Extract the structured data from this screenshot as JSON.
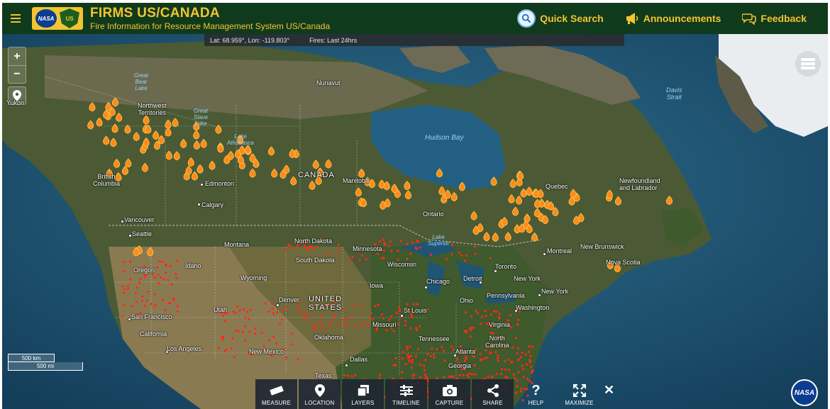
{
  "header": {
    "title": "FIRMS US/CANADA",
    "subtitle": "Fire Information for Resource Management System US/Canada",
    "logo_left": "NASA",
    "logo_right": "US",
    "actions": {
      "quick_search": "Quick Search",
      "announcements": "Announcements",
      "feedback": "Feedback"
    },
    "colors": {
      "bar": "#103a1c",
      "accent": "#f4c430"
    }
  },
  "coord_bar": {
    "latlon": "Lat: 68.959°, Lon: -119.803°",
    "fires": "Fires: Last 24hrs"
  },
  "map_controls": {
    "zoom_in": "+",
    "zoom_out": "−"
  },
  "labels": {
    "yukon": "Yukon",
    "great_bear_lake": "Great\nBear\nLake",
    "nunavut": "Nunavut",
    "northwest_territories": "Northwest\nTerritories",
    "great_slave_lake": "Great\nSlave\nLake",
    "lake_athabasca": "Lake\nAthabasca",
    "hudson_bay": "Hudson Bay",
    "davis_strait": "Davis\nStrait",
    "british_columbia": "British\nColumbia",
    "canada": "CANADA",
    "edmonton": "Edmonton",
    "manitoba": "Manitoba",
    "quebec": "Quebec",
    "newfoundland": "Newfoundland\nand Labrador",
    "calgary": "Calgary",
    "ontario": "Ontario",
    "vancouver": "Vancouver",
    "seattle": "Seattle",
    "north_dakota": "North Dakota",
    "lake_superior": "Lake\nSuperior",
    "montreal": "Montreal",
    "new_brunswick": "New Brunswick",
    "montana": "Montana",
    "minnesota": "Minnesota",
    "oregon": "Oregon",
    "idaho": "Idaho",
    "south_dakota": "South Dakota",
    "wisconsin": "Wisconsin",
    "toronto": "Toronto",
    "nova_scotia": "Nova Scotia",
    "wyoming": "Wyoming",
    "detroit": "Detroit",
    "new_york": "New York",
    "chicago": "Chicago",
    "iowa": "Iowa",
    "pennsylvania": "Pennsylvania",
    "new_york_city": "New York",
    "denver": "Denver",
    "united_states": "UNITED\nSTATES",
    "ohio": "Ohio",
    "san_francisco": "San Francisco",
    "utah": "Utah",
    "st_louis": "St Louis",
    "washington": "Washington",
    "california": "California",
    "missouri": "Missouri",
    "virginia": "Virginia",
    "oklahoma": "Oklahoma",
    "tennessee": "Tennessee",
    "north_carolina": "North\nCarolina",
    "los_angeles": "Los Angeles",
    "new_mexico": "New Mexico",
    "atlanta": "Atlanta",
    "dallas": "Dallas",
    "georgia": "Georgia",
    "texas": "Texas"
  },
  "scale": {
    "km": "500 km",
    "mi": "500 mi"
  },
  "toolbar": {
    "items": [
      {
        "label": "MEASURE",
        "icon": "ruler-icon"
      },
      {
        "label": "LOCATION",
        "icon": "map-pin-icon"
      },
      {
        "label": "LAYERS",
        "icon": "layers-icon"
      },
      {
        "label": "TIMELINE",
        "icon": "sliders-icon"
      },
      {
        "label": "CAPTURE",
        "icon": "camera-icon"
      },
      {
        "label": "SHARE",
        "icon": "share-icon"
      },
      {
        "label": "HELP",
        "icon": "help-icon"
      },
      {
        "label": "MAXIMIZE",
        "icon": "maximize-icon"
      }
    ],
    "close": "✕"
  },
  "corner_logo": "NASA"
}
